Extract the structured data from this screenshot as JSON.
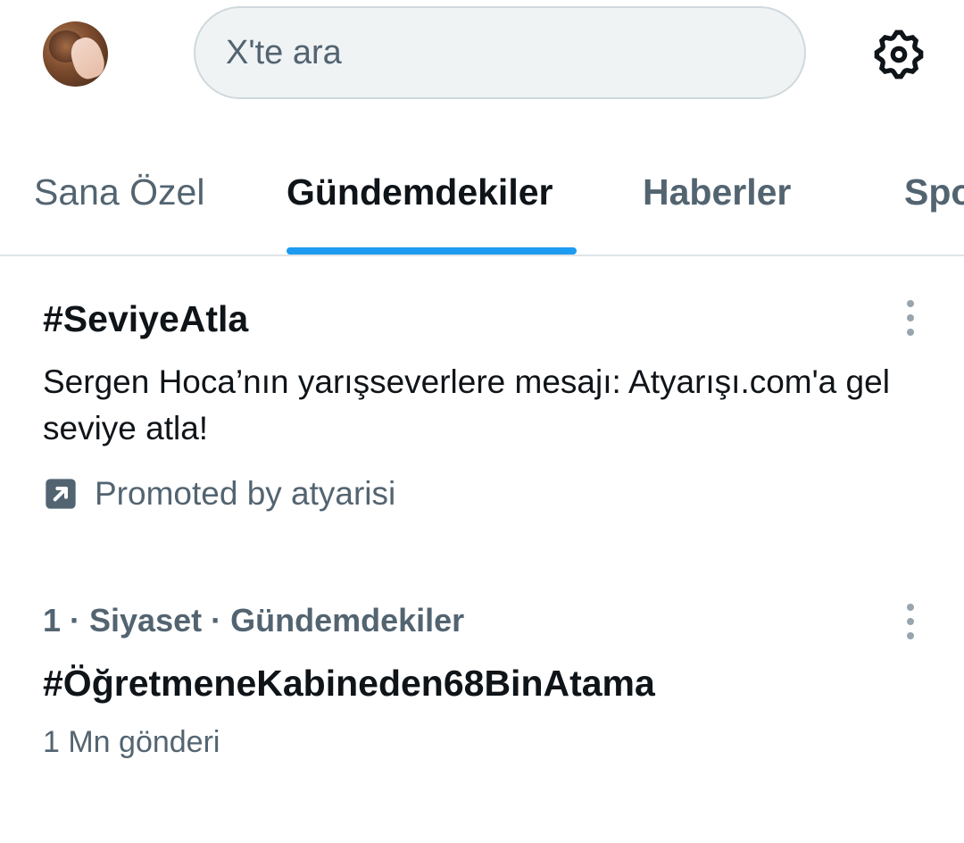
{
  "header": {
    "search": {
      "placeholder": "X'te ara"
    }
  },
  "tabs": [
    {
      "label": "Sana Özel",
      "active": false
    },
    {
      "label": "Gündemdekiler",
      "active": true
    },
    {
      "label": "Haberler",
      "active": false
    },
    {
      "label": "Spo",
      "active": false
    }
  ],
  "trends": [
    {
      "title": "#SeviyeAtla",
      "description": "Sergen Hoca’nın yarışseverlere mesajı: Atyarışı.com'a gel seviye atla!",
      "promoted_label": "Promoted by atyarisi"
    },
    {
      "meta": "1 · Siyaset · Gündemdekiler",
      "title": "#ÖğretmeneKabineden68BinAtama",
      "post_count": "1 Mn gönderi"
    }
  ],
  "colors": {
    "accent": "#1d9bf0",
    "text_primary": "#0f1419",
    "text_secondary": "#536471",
    "search_bg": "#eff3f4"
  },
  "icons": {
    "settings": "gear-icon",
    "promoted": "promoted-arrow-icon",
    "more": "more-vertical-icon"
  }
}
